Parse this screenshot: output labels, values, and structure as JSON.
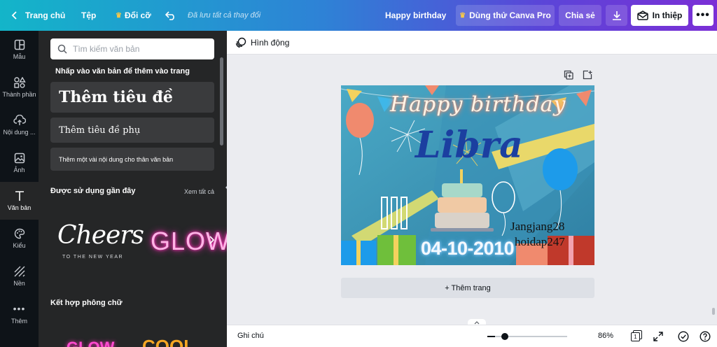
{
  "topbar": {
    "home_label": "Trang chủ",
    "file_label": "Tệp",
    "resize_label": "Đổi cỡ",
    "save_status": "Đã lưu tất cả thay đổi",
    "design_title": "Happy birthday",
    "try_pro_label": "Dùng thử Canva Pro",
    "share_label": "Chia sẻ",
    "print_label": "In thiệp"
  },
  "rail": {
    "items": [
      {
        "label": "Mẫu",
        "icon": "template-icon"
      },
      {
        "label": "Thành phần",
        "icon": "elements-icon"
      },
      {
        "label": "Nội dung ...",
        "icon": "upload-icon"
      },
      {
        "label": "Ảnh",
        "icon": "photo-icon"
      },
      {
        "label": "Văn bản",
        "icon": "text-icon"
      },
      {
        "label": "Kiểu",
        "icon": "palette-icon"
      },
      {
        "label": "Nền",
        "icon": "background-icon"
      },
      {
        "label": "Thêm",
        "icon": "more-dots-icon"
      }
    ]
  },
  "panel": {
    "search_placeholder": "Tìm kiếm văn bản",
    "click_hint": "Nhấp vào văn bản để thêm vào trang",
    "add_heading": "Thêm tiêu đề",
    "add_subheading": "Thêm tiêu đề phụ",
    "add_body": "Thêm một vài nội dung cho thân văn bản",
    "recent_title": "Được sử dụng gần đây",
    "see_all": "Xem tất cả",
    "recent_items": [
      {
        "text": "Cheers",
        "subtext": "TO THE NEW YEAR"
      },
      {
        "text": "GLOW",
        "subtext": ""
      }
    ],
    "font_combo_title": "Kết hợp phông chữ",
    "combo_items": [
      "GLOW",
      "COOL"
    ]
  },
  "subbar": {
    "animate_label": "Hình động"
  },
  "design": {
    "greeting": "Happy birthday",
    "name": "Libra",
    "date": "04-10-2010",
    "credit_line1": "Jangjang28",
    "credit_line2": "hoidap247",
    "colors": {
      "background": "#3a97b6",
      "balloon_orange": "#f08a6e",
      "balloon_blue": "#1d9bea",
      "name_blue": "#1b3fa0"
    }
  },
  "add_page_label": "+ Thêm trang",
  "bottombar": {
    "notes_label": "Ghi chú",
    "zoom": "86%",
    "page_number": "1",
    "zoom_fraction": 0.1
  }
}
